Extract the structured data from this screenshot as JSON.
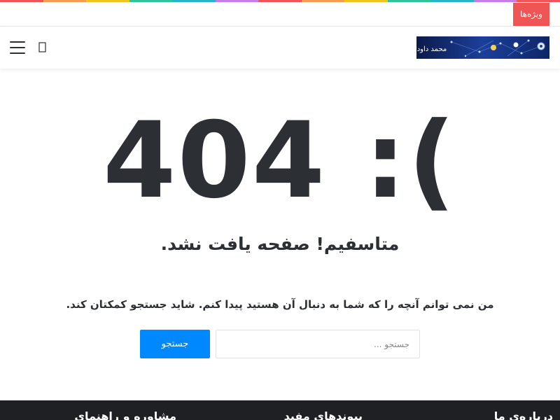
{
  "top_stripe_colors": [
    "#f05555",
    "#f0a050",
    "#f0c41b",
    "#2dc69a",
    "#22b8c9",
    "#c77ce8",
    "#f05555",
    "#f0a050",
    "#f0c41b",
    "#2dc69a",
    "#22b8c9",
    "#c77ce8",
    "#f05555"
  ],
  "topbar": {
    "features_label": "ویژه‌ها"
  },
  "header": {
    "menu_icon": "hamburger-icon",
    "search_icon": "search-icon",
    "logo_text": "محمد داود"
  },
  "error": {
    "code": "404 :(",
    "title": "متاسفیم! صفحه یافت نشد.",
    "description": "من نمی توانم آنچه را که شما به دنبال آن هستید پیدا کنم. شاید جستجو کمکتان کند."
  },
  "search": {
    "placeholder": "جستجو ...",
    "value": "",
    "button_label": "جستجو"
  },
  "footer": {
    "headings": [
      "درباره‌ی ما",
      "پیوندهای مفید",
      "مشاوره و راهنمای"
    ]
  },
  "colors": {
    "accent": "#0088ff",
    "features": "#f05555",
    "footer_bg": "#1f2024"
  }
}
